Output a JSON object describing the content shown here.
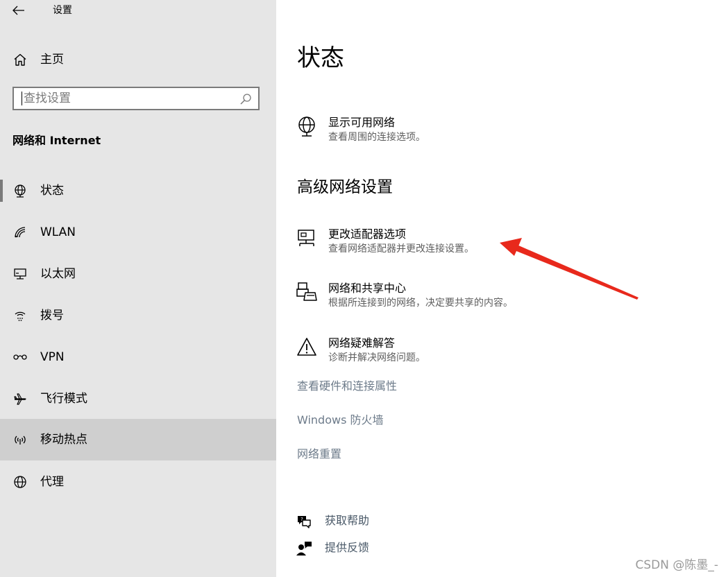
{
  "window": {
    "title": "设置"
  },
  "sidebar": {
    "home_label": "主页",
    "search_placeholder": "查找设置",
    "section_heading": "网络和 Internet",
    "items": [
      {
        "label": "状态",
        "icon": "globe-status-icon",
        "active": true
      },
      {
        "label": "WLAN",
        "icon": "wifi-icon"
      },
      {
        "label": "以太网",
        "icon": "ethernet-icon"
      },
      {
        "label": "拨号",
        "icon": "dialup-icon"
      },
      {
        "label": "VPN",
        "icon": "vpn-icon"
      },
      {
        "label": "飞行模式",
        "icon": "airplane-icon"
      },
      {
        "label": "移动热点",
        "icon": "hotspot-icon",
        "hovered": true
      },
      {
        "label": "代理",
        "icon": "proxy-globe-icon"
      }
    ]
  },
  "main": {
    "title": "状态",
    "show_networks": {
      "title": "显示可用网络",
      "desc": "查看周围的连接选项。"
    },
    "advanced_heading": "高级网络设置",
    "advanced_items": [
      {
        "title": "更改适配器选项",
        "desc": "查看网络适配器并更改连接设置。",
        "icon": "adapter-monitor-icon"
      },
      {
        "title": "网络和共享中心",
        "desc": "根据所连接到的网络，决定要共享的内容。",
        "icon": "sharing-printer-icon"
      },
      {
        "title": "网络疑难解答",
        "desc": "诊断并解决网络问题。",
        "icon": "warning-triangle-icon"
      }
    ],
    "links": [
      "查看硬件和连接属性",
      "Windows 防火墙",
      "网络重置"
    ],
    "help": [
      {
        "label": "获取帮助",
        "icon": "help-chat-icon"
      },
      {
        "label": "提供反馈",
        "icon": "feedback-person-icon"
      }
    ]
  },
  "watermark": "CSDN @陈墨_-",
  "colors": {
    "sidebar_bg": "#e6e6e6",
    "hover_bg": "#cfcfcf",
    "link": "#6d7b8a",
    "annotation": "#e8291c"
  }
}
